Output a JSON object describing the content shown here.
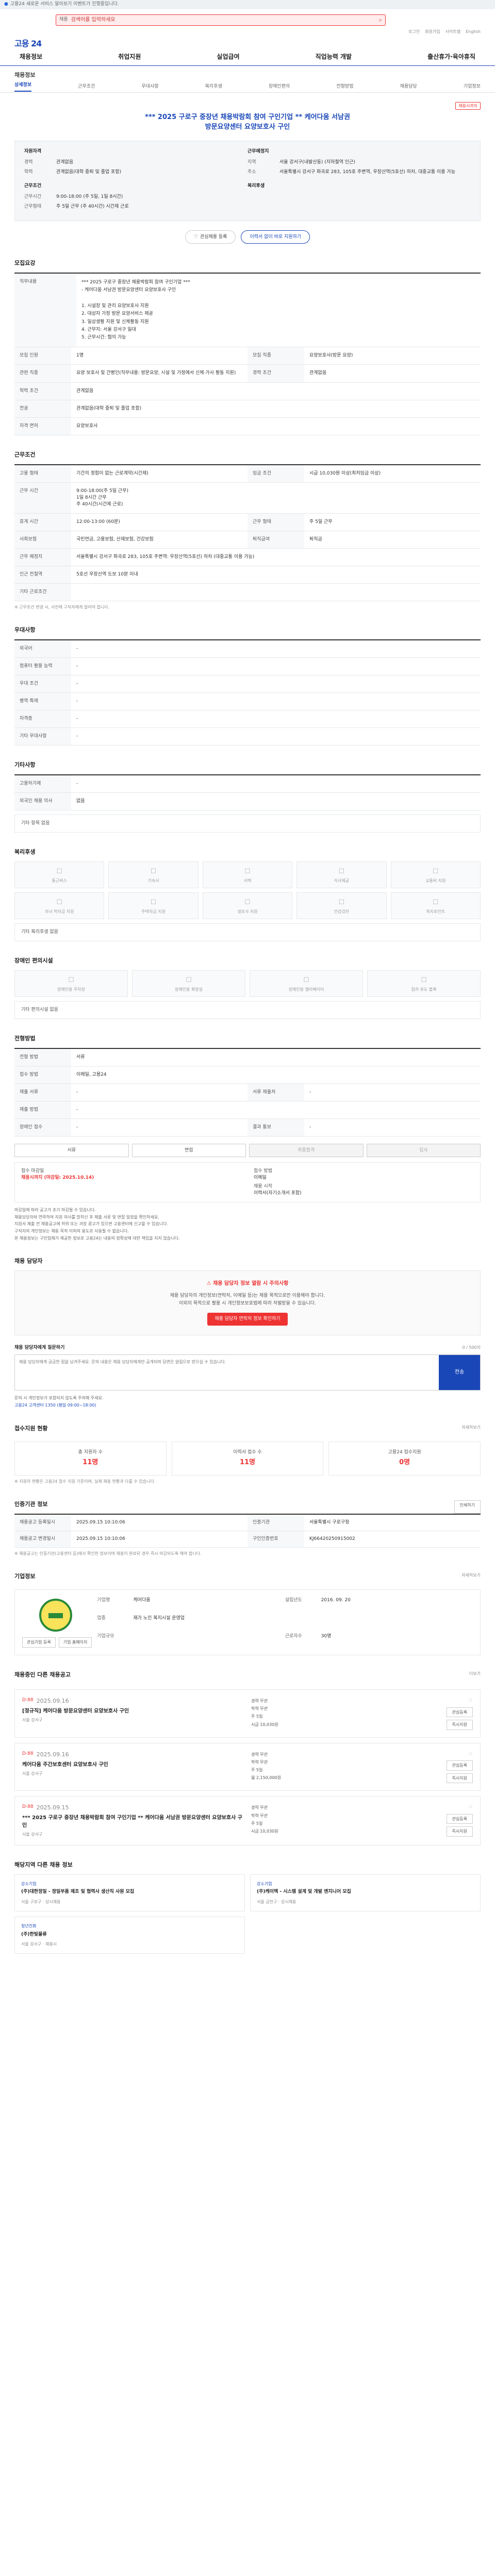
{
  "topbar": {
    "notice": "고용24 새로운 서비스 알아보기 이벤트가 진행중입니다."
  },
  "search": {
    "category": "채용",
    "query": "검색어를 입력하세요"
  },
  "util": [
    "로그인",
    "회원가입",
    "사이트맵",
    "English"
  ],
  "logo": "고용 24",
  "gnb": [
    "채용정보",
    "취업지원",
    "실업급여",
    "직업능력 개발",
    "출산휴가·육아휴직"
  ],
  "crumb": "채용정보",
  "subtabs": [
    {
      "label": "상세정보",
      "active": true
    },
    {
      "label": "근무조건",
      "active": false
    },
    {
      "label": "우대사항",
      "active": false
    },
    {
      "label": "복리후생",
      "active": false
    },
    {
      "label": "장애인편의",
      "active": false
    },
    {
      "label": "전형방법",
      "active": false
    },
    {
      "label": "채용담당",
      "active": false
    },
    {
      "label": "기업정보",
      "active": false
    }
  ],
  "status_badge": "채용시까지",
  "title_line1": "*** 2025 구로구 중장년 채용박람회 참여 구인기업 ** 케어다움 서남권",
  "title_line2": "방문요양센터 요양보호사 구인",
  "summary": {
    "left_heading": "자원자격",
    "left": [
      {
        "k": "경력",
        "v": "관계없음"
      },
      {
        "k": "학력",
        "v": "관계없음(대학 중퇴 및 졸업 포함)"
      },
      {
        "k": "",
        "v": ""
      }
    ],
    "left_heading2": "근무조건",
    "left2": [
      {
        "k": "근무시간",
        "v": "9:00-18:00 (주 5일, 1일 8시간)"
      },
      {
        "k": "근무형태",
        "v": "주 5일 근무 (주 40시간) 시간제 근로"
      }
    ],
    "right_heading": "근무예정지",
    "right": [
      {
        "k": "지역",
        "v": "서울 강서구(내발산동) (지하철역 인근)"
      },
      {
        "k": "주소",
        "v": "서울특별시 강서구 화곡로 283, 105호 주변역, 우장산역(5호선) 하차, 대중교통 이용 가능"
      }
    ],
    "right_heading2": "복리후생"
  },
  "buttons": {
    "favorite": "관심채용 등록",
    "share": "이력서 없이 바로 지원하기"
  },
  "sections": {
    "job_detail": "모집요강",
    "work_cond": "근무조건",
    "preferred": "우대사항",
    "etc": "기타사항",
    "welfare": "복리후생",
    "disabled": "장애인 편의시설",
    "process": "전형방법",
    "contact": "채용 담당자",
    "apply_stats": "접수지원 현황",
    "recruit_info": "인증기관 정보",
    "company": "기업정보",
    "related": "채용중인 다른 채용공고",
    "other_jobs": "해당지역 다른 채용 정보"
  },
  "detail": {
    "label": "직무내용",
    "text": "*** 2025 구로구 중장년 채용박람회 참여 구인기업 ***\n- 케어다움 서남권 방문요양센터 요양보호사 구인\n\n1. 시설장 및 관리 요양보호사 지원\n2. 대상자 가정 방문 요양서비스 제공\n3. 일상생활 지원 및 신체활동 지원\n4. 근무지: 서울 강서구 일대\n5. 근무시간: 협의 가능",
    "rows": [
      {
        "k": "모집 인원",
        "v": "1명",
        "k2": "모집 직종",
        "v2": "요양보호사(방문 요양)"
      },
      {
        "k": "관련 직종",
        "v": "요양 보호사 및 간병인(직무내용: 방문요양, 시설 및 가정에서 신체·가사 활동 지원)",
        "k2": "경력 조건",
        "v2": "관계없음"
      },
      {
        "k": "학력 조건",
        "v": "관계없음",
        "k2": "",
        "v2": ""
      },
      {
        "k": "전공",
        "v": "관계없음(대학 중퇴 및 졸업 포함)",
        "k2": "",
        "v2": ""
      },
      {
        "k": "자격 면허",
        "v": "요양보호사",
        "k2": "",
        "v2": ""
      }
    ]
  },
  "work": {
    "rows": [
      {
        "k": "고용 형태",
        "v": "기간의 정함이 없는 근로계약(시간제)",
        "k2": "임금 조건",
        "v2": "시급 10,030원 이상(최저임금 이상)"
      },
      {
        "k": "근무 시간",
        "v": "9:00-18:00(주 5일 근무)\n1일 8시간 근무\n주 40시간(시간제 근로)"
      },
      {
        "k": "휴게 시간",
        "v": "12:00-13:00 (60분)",
        "k2": "근무 형태",
        "v2": "주 5일 근무"
      },
      {
        "k": "사회보험",
        "v": "국민연금, 고용보험, 산재보험, 건강보험",
        "k2": "퇴직급여",
        "v2": "퇴직금"
      },
      {
        "k": "근무 예정지",
        "v": "서울특별시 강서구 화곡로 283, 105호 주변역: 우장산역(5호선) 하차 (대중교통 이용 가능)",
        "k2": "",
        "v2": ""
      },
      {
        "k": "인근 전철역",
        "v": "5호선 우장산역 도보 10분 이내",
        "k2": "",
        "v2": ""
      },
      {
        "k": "기타 근로조건",
        "v": "",
        "k2": "",
        "v2": ""
      }
    ],
    "map_btn": "지도 보기",
    "note": "※ 근무조건 변경 시, 사전에 구직자에게 알려야 합니다."
  },
  "pref": {
    "rows": [
      {
        "k": "외국어",
        "v": "-"
      },
      {
        "k": "컴퓨터 활용 능력",
        "v": "-"
      },
      {
        "k": "우대 조건",
        "v": "-"
      },
      {
        "k": "병역 특례",
        "v": "-"
      },
      {
        "k": "자격증",
        "v": "-"
      },
      {
        "k": "기타 우대사항",
        "v": "-"
      }
    ]
  },
  "etc": {
    "rows": [
      {
        "k": "고용허가제",
        "v": "-"
      },
      {
        "k": "외국인 채용 의사",
        "v": "없음"
      }
    ],
    "box": "기타 항목 없음"
  },
  "welfare": {
    "items": [
      "통근버스",
      "기숙사",
      "사택",
      "식사제공",
      "교통비 지원",
      "자녀 학자금 지원",
      "주택자금 지원",
      "경조사 지원",
      "건강검진",
      "복지포인트"
    ],
    "box": "기타 복리후생 없음"
  },
  "disabled_fac": {
    "items": [
      "장애인용 주차장",
      "장애인용 화장실",
      "장애인용 엘리베이터",
      "점자 유도 블록"
    ],
    "box": "기타 편의시설 없음"
  },
  "procinfo": {
    "rows": [
      {
        "k": "전형 방법",
        "v": "서류",
        "k2": "",
        "v2": ""
      },
      {
        "k": "접수 방법",
        "v": "이메일, 고용24",
        "k2": "",
        "v2": ""
      },
      {
        "k": "제출 서류",
        "v": "-",
        "k2": "서류 제출처",
        "v2": "-"
      },
      {
        "k": "제출 방법",
        "v": "-",
        "k2": "",
        "v2": ""
      },
      {
        "k": "장애인 접수",
        "v": "-",
        "k2": "결과 통보",
        "v2": "-"
      }
    ]
  },
  "steps": [
    {
      "label": "서류",
      "dim": false
    },
    {
      "label": "면접",
      "dim": false
    },
    {
      "label": "최종합격",
      "dim": true
    },
    {
      "label": "입사",
      "dim": true
    }
  ],
  "proc_box": {
    "k1": "접수 마감일",
    "v1": "채용시까지 (마감일: 2025.10.14)",
    "k2": "접수 방법",
    "v2": "이메일",
    "k3": "채용 시작",
    "v3": "이력서(자기소개서 포함)"
  },
  "proc_bullets": [
    "마감일에 따라 공고가 조기 마감될 수 있습니다.",
    "채용담당자와 연락하여 지원 의사를 밝히신 후 제출 서류 및 면접 일정을 확인하세요.",
    "지원서 제출 전 채용공고에 허위 또는 과장 광고가 있으면 고용센터에 신고할 수 있습니다.",
    "구직자의 개인정보는 채용 목적 이외의 용도로 사용될 수 없습니다.",
    "본 채용정보는 구인업체가 제공한 정보로 고용24는 내용의 정확성에 대한 책임을 지지 않습니다."
  ],
  "contact": {
    "warn": "채용 담당자 정보 열람 시 주의사항",
    "text1": "채용 담당자의 개인정보(연락처, 이메일 등)는 채용 목적으로만 이용해야 합니다.",
    "text2": "이외의 목적으로 활용 시 개인정보보호법에 따라 처벌받을 수 있습니다.",
    "cta": "채용 담당자 연락처 정보 확인하기",
    "inq_title": "채용 담당자에게 질문하기",
    "inq_count": "0 / 500자",
    "inq_placeholder": "채용 담당자에게 궁금한 점을 남겨주세요. 문의 내용은 채용 담당자에게만 공개되며 답변은 알림으로 받으실 수 있습니다.",
    "send": "전송",
    "notes": [
      "문의 시 개인정보가 포함되지 않도록 주의해 주세요.",
      "고용24 고객센터 1350 (평일 09:00~18:00)"
    ]
  },
  "stats": {
    "more": "자세히보기",
    "items": [
      {
        "l": "총 지원자 수",
        "n": "11명"
      },
      {
        "l": "이력서 접수 수",
        "n": "11명"
      },
      {
        "l": "고용24 접수지원",
        "n": "0명"
      }
    ],
    "note": "※ 지원자 현황은 고용24 접수 지원 기준이며, 실제 채용 현황과 다를 수 있습니다."
  },
  "recinfo": {
    "print": "인쇄하기",
    "rows": [
      {
        "k": "채용공고 등록일시",
        "v": "2025.09.15 10:10:06",
        "k2": "인증기관",
        "v2": "서울특별시 구로구청"
      },
      {
        "k": "채용공고 변경일시",
        "v": "2025.09.15 10:10:06",
        "k2": "구인인증번호",
        "v2": "KJ66420250915002"
      }
    ],
    "note": "※ 채용공고는 인증기관(고용센터 등)에서 확인한 정보이며 채용이 완료된 경우 즉시 마감되도록 해야 합니다."
  },
  "company": {
    "more": "자세히보기",
    "rows": [
      {
        "k": "기업명",
        "v": "케어다움",
        "k2": "설립년도",
        "v2": "2016. 09. 20"
      },
      {
        "k": "업종",
        "v": "재가 노인 복지시설 운영업",
        "k2": "",
        "v2": ""
      },
      {
        "k": "기업규모",
        "v": "",
        "k2": "근로자수",
        "v2": "30명"
      }
    ],
    "btns": [
      "관심기업 등록",
      "기업 홈페이지"
    ]
  },
  "jobs": {
    "more": "더보기",
    "items": [
      {
        "dday": "D-88",
        "date": "2025.09.16",
        "title": "[정규직] 케어다움 방문요양센터 요양보호사 구인",
        "sub": "서울 강서구",
        "info": [
          "경력 무관",
          "학력 무관",
          "주 5일",
          "시급 10,030원"
        ],
        "btn1": "관심등록",
        "btn2": "즉시지원"
      },
      {
        "dday": "D-88",
        "date": "2025.09.16",
        "title": "케어다움 주간보호센터 요양보호사 구인",
        "sub": "서울 강서구",
        "info": [
          "경력 무관",
          "학력 무관",
          "주 5일",
          "월 2,150,000원"
        ],
        "btn1": "관심등록",
        "btn2": "즉시지원"
      },
      {
        "dday": "D-88",
        "date": "2025.09.15",
        "title": "*** 2025 구로구 중장년 채용박람회 참여 구인기업 ** 케어다움 서남권 방문요양센터 요양보호사 구인",
        "sub": "서울 강서구",
        "info": [
          "경력 무관",
          "학력 무관",
          "주 5일",
          "시급 10,030원"
        ],
        "btn1": "관심등록",
        "btn2": "즉시지원"
      }
    ]
  },
  "corps": [
    {
      "tag": "강소기업",
      "name": "(주)대한정밀 - 정밀부품 제조 및 협력사 생산직 사원 모집",
      "meta": "서울 구로구 · 상시채용"
    },
    {
      "tag": "강소기업",
      "name": "(주)케이텍 - 시스템 설계 및 개발 엔지니어 모집",
      "meta": "서울 금천구 · 상시채용"
    },
    {
      "tag": "청년친화",
      "name": "(주)한빛물류",
      "meta": "서울 강서구 · 채용시"
    }
  ]
}
